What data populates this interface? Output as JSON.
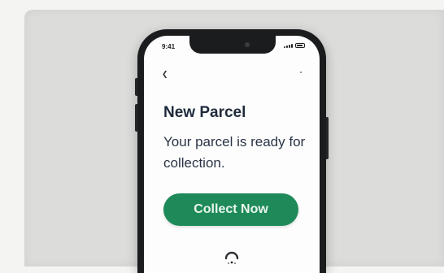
{
  "status_bar": {
    "time": "9:41"
  },
  "notification": {
    "title": "New Parcel",
    "message": "Your parcel is ready for collection.",
    "action_label": "Collect Now"
  },
  "icons": {
    "back": "chevron-left-icon",
    "loading": "loading-spinner-icon"
  },
  "colors": {
    "accent": "#1f8a59",
    "title_text": "#1f2a3c",
    "phone_body": "#1b1c1e"
  }
}
